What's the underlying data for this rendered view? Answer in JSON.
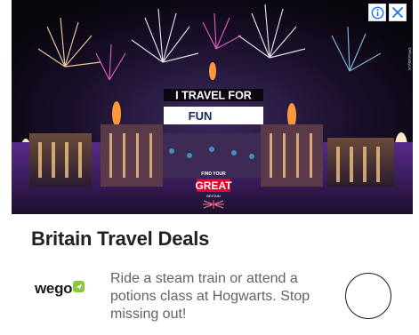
{
  "ad": {
    "image": {
      "banner_line1": "I TRAVEL FOR",
      "banner_line2": "FUN",
      "brand_tag": "FIND YOUR",
      "brand_name": "GREAT",
      "brand_sub": "BRITAIN",
      "photo_credit": "©PhotoByUs"
    },
    "adchoices": {
      "info_icon": "info-icon",
      "close_icon": "close-icon",
      "accent": "#1a73e8"
    },
    "headline": "Britain Travel Deals",
    "advertiser": {
      "logo_text": "wego",
      "logo_accent": "#8cc63f"
    },
    "description": "Ride a steam train or attend a potions class at Hogwarts. Stop missing out!",
    "cta_icon": "chevron-right-icon"
  }
}
